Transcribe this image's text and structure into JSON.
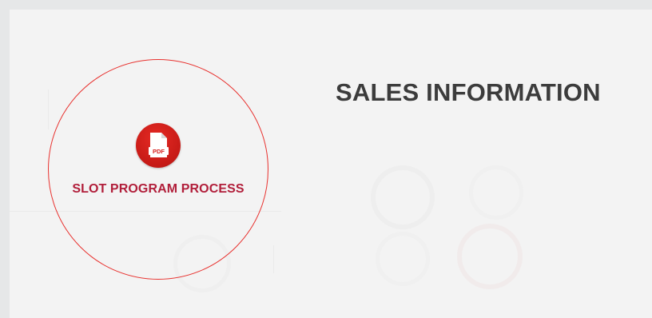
{
  "section": {
    "heading": "SALES INFORMATION"
  },
  "document_link": {
    "label": "SLOT PROGRAM PROCESS",
    "icon": "pdf-icon",
    "icon_text": "PDF",
    "ring_color": "#e8322f",
    "label_color": "#b11e3a"
  },
  "colors": {
    "page_background": "#e6e7e8",
    "panel_background": "#f3f3f3",
    "heading": "#3c3c3c",
    "icon_red": "#d7201d"
  }
}
